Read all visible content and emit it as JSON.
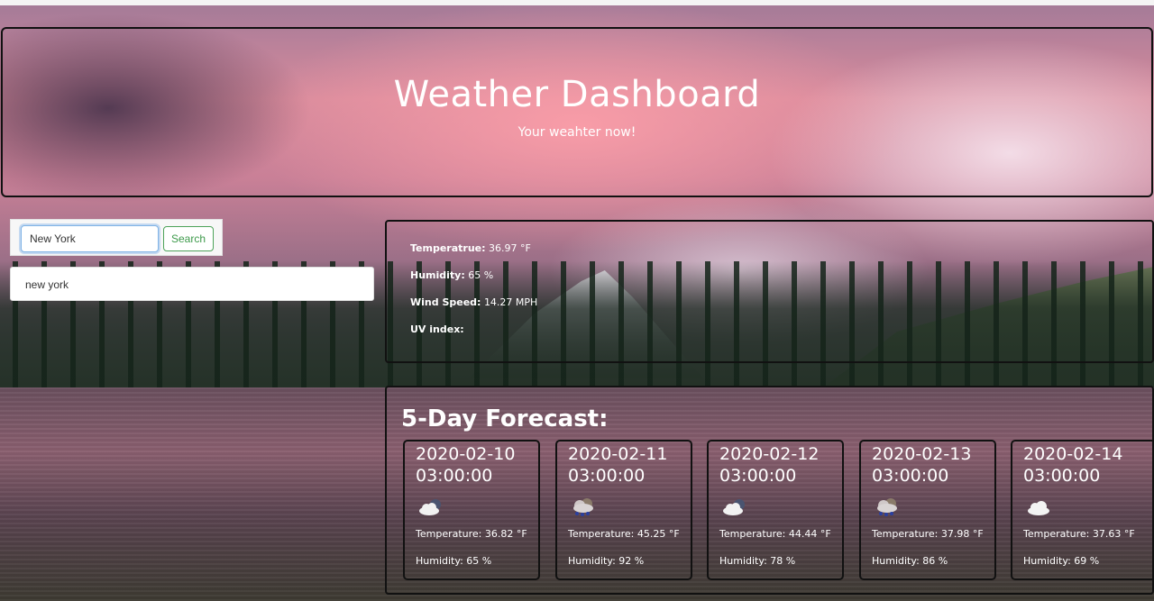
{
  "header": {
    "title": "Weather Dashboard",
    "subtitle": "Your weahter now!"
  },
  "search": {
    "value": "New York",
    "button_label": "Search",
    "history": [
      "new york"
    ]
  },
  "current": {
    "temperature_label": "Temperatrue:",
    "temperature_value": "36.97 °F",
    "humidity_label": "Humidity:",
    "humidity_value": "65 %",
    "wind_label": "Wind Speed:",
    "wind_value": "14.27 MPH",
    "uv_label": "UV index:"
  },
  "forecast": {
    "title": "5-Day Forecast:",
    "days": [
      {
        "date": "2020-02-10",
        "time": "03:00:00",
        "icon": "cloudy-night-icon",
        "temperature": "Temperature: 36.82 °F",
        "humidity": "Humidity: 65 %"
      },
      {
        "date": "2020-02-11",
        "time": "03:00:00",
        "icon": "rain-night-icon",
        "temperature": "Temperature: 45.25 °F",
        "humidity": "Humidity: 92 %"
      },
      {
        "date": "2020-02-12",
        "time": "03:00:00",
        "icon": "cloudy-night-icon",
        "temperature": "Temperature: 44.44 °F",
        "humidity": "Humidity: 78 %"
      },
      {
        "date": "2020-02-13",
        "time": "03:00:00",
        "icon": "rain-night-icon",
        "temperature": "Temperature: 37.98 °F",
        "humidity": "Humidity: 86 %"
      },
      {
        "date": "2020-02-14",
        "time": "03:00:00",
        "icon": "cloud-icon",
        "temperature": "Temperature: 37.63 °F",
        "humidity": "Humidity: 69 %"
      }
    ]
  }
}
